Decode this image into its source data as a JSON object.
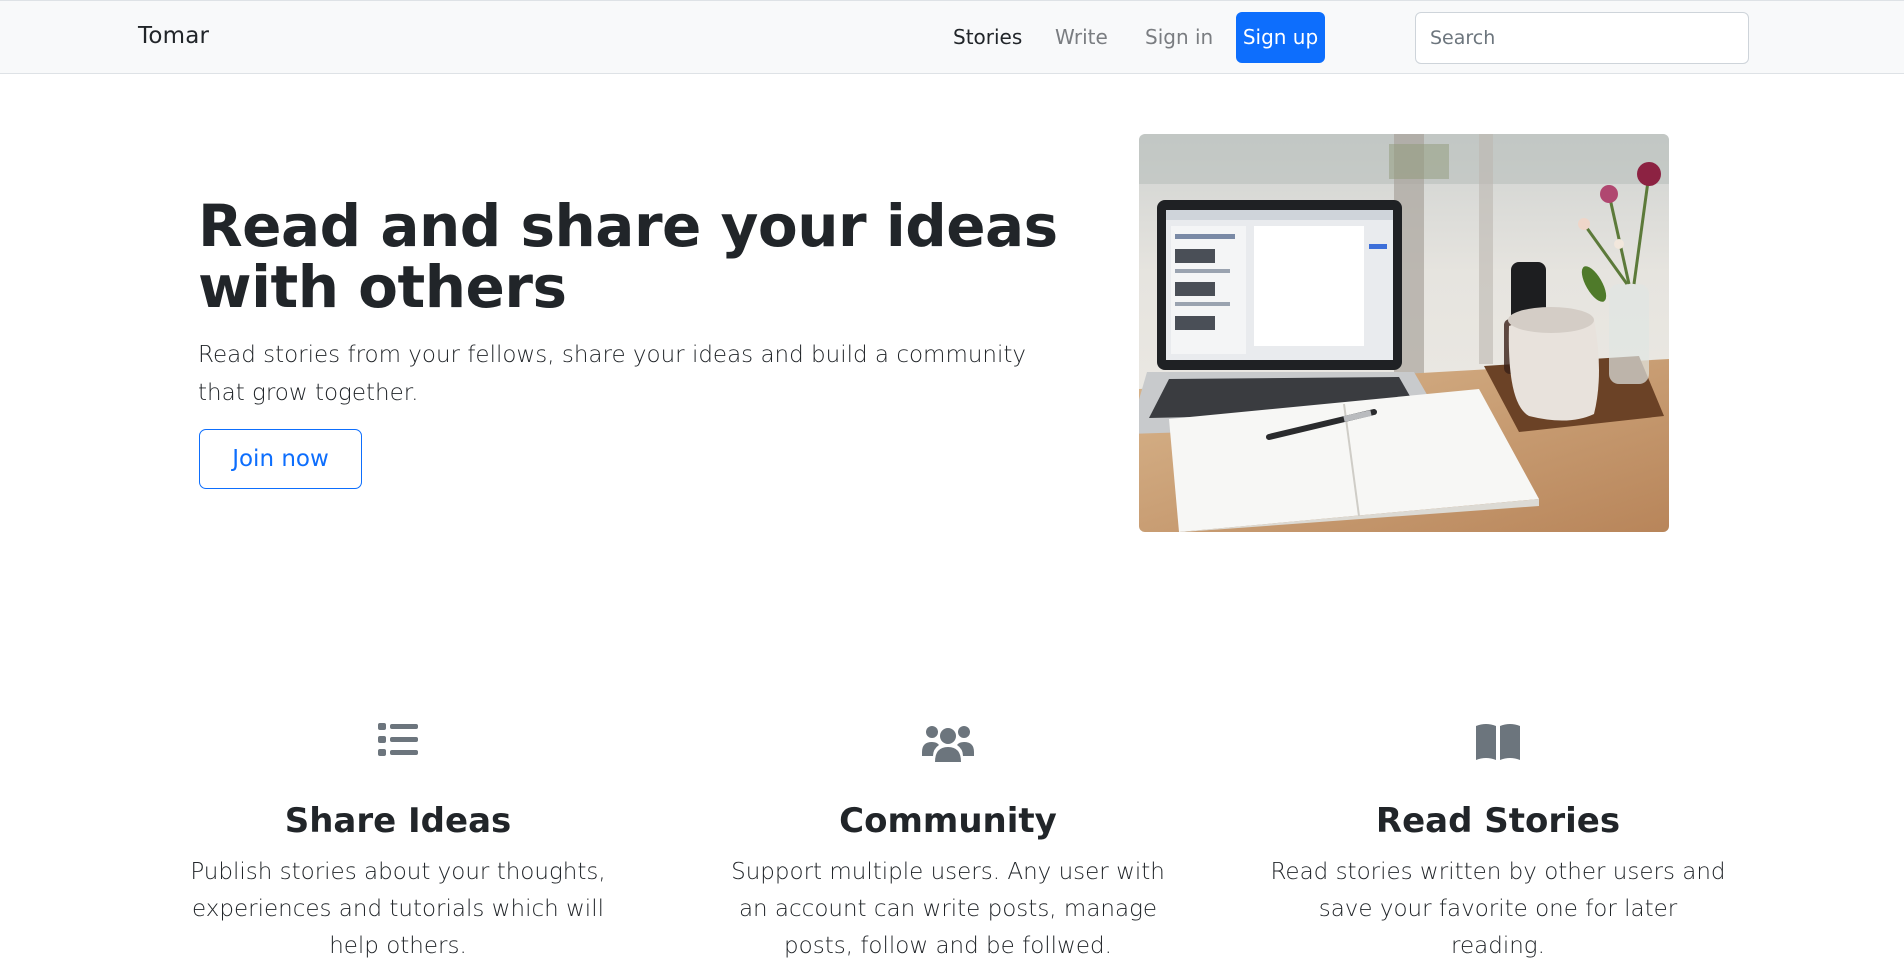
{
  "navbar": {
    "brand": "Tomar",
    "links": [
      "Stories",
      "Write",
      "Sign in"
    ],
    "signup_label": "Sign up",
    "search_placeholder": "Search"
  },
  "hero": {
    "title": "Read and share your ideas with others",
    "lead": "Read stories from your fellows, share your ideas and build a community that grow together.",
    "cta_label": "Join now",
    "image_icon": "laptop-notebook-photo"
  },
  "features": [
    {
      "icon": "list-icon",
      "title": "Share Ideas",
      "text": "Publish stories about your thoughts, experiences and tutorials which will help others."
    },
    {
      "icon": "users-icon",
      "title": "Community",
      "text": "Support multiple users. Any user with an account can write posts, manage posts, follow and be follwed."
    },
    {
      "icon": "book-icon",
      "title": "Read Stories",
      "text": "Read stories written by other users and save your favorite one for later reading."
    }
  ],
  "colors": {
    "primary": "#0d6efd",
    "navbar_bg": "#f8f9fa",
    "icon_gray": "#6c757d"
  }
}
